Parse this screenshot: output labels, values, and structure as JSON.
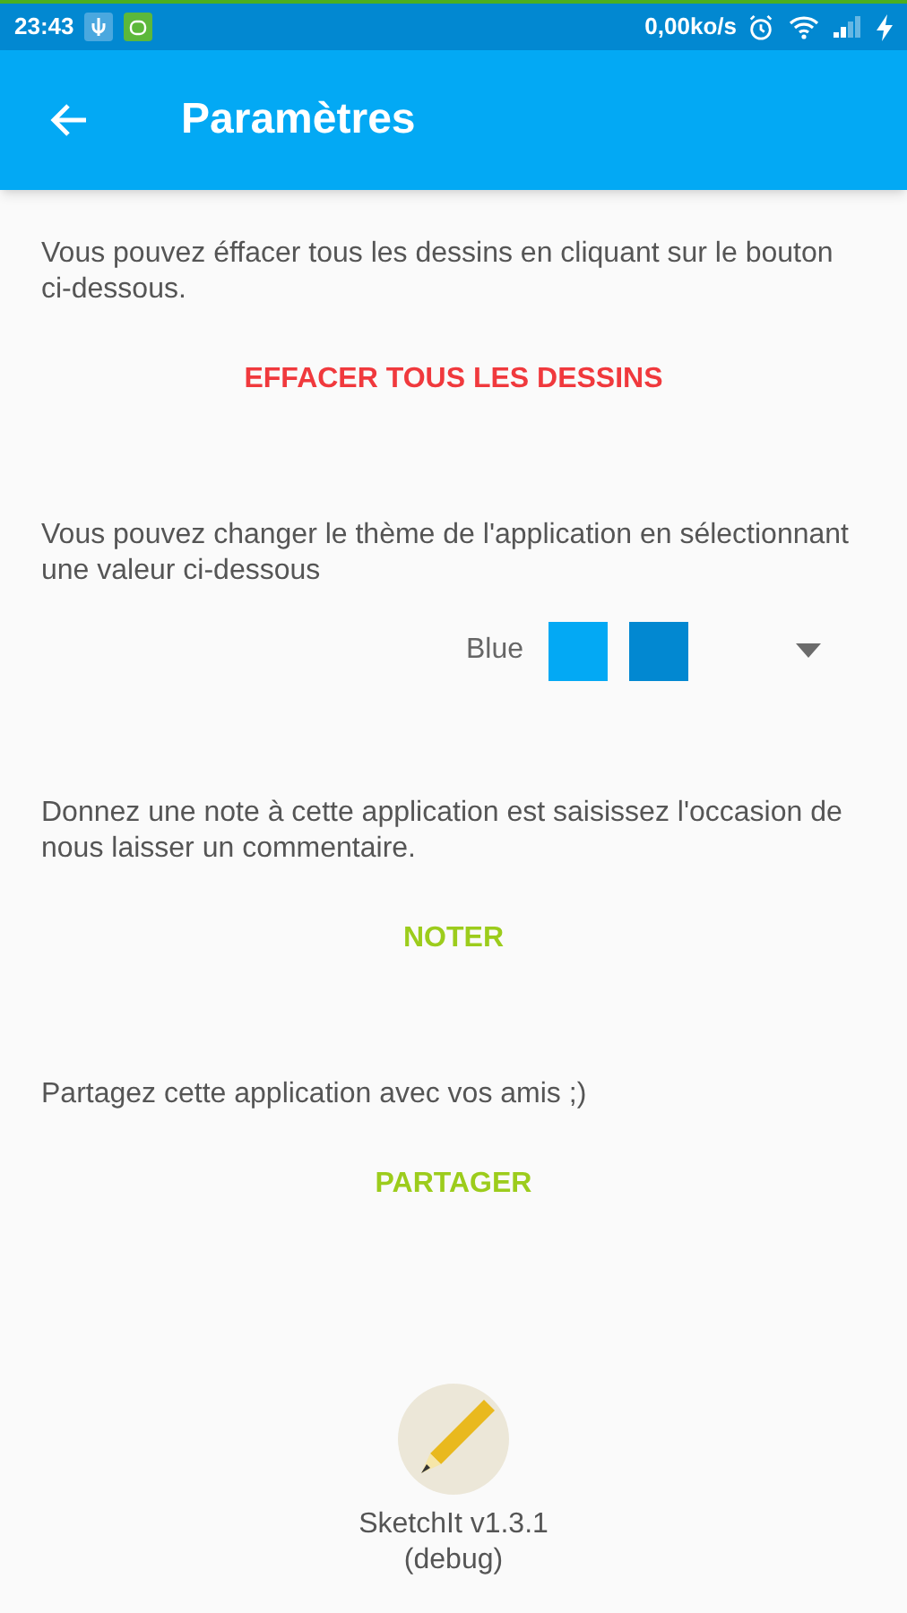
{
  "status_bar": {
    "time": "23:43",
    "speed": "0,00ko/s"
  },
  "app_bar": {
    "title": "Paramètres"
  },
  "sections": [
    {
      "text": "Vous pouvez éffacer tous les dessins en cliquant sur le bouton ci-dessous.",
      "kind": "button",
      "action": "EFFACER TOUS LES DESSINS",
      "color": "#f0393d"
    },
    {
      "text": "Vous pouvez changer le thème de l'application en sélectionnant une valeur ci-dessous",
      "kind": "theme",
      "theme": {
        "name": "Blue",
        "swatches": [
          {
            "color": "#03a9f4"
          },
          {
            "color": "#0288d1"
          }
        ]
      }
    },
    {
      "text": "Donnez une note à cette application est saisissez l'occasion de nous laisser un commentaire.",
      "kind": "button",
      "action": "NOTER",
      "color": "#9ccc1c"
    },
    {
      "text": "Partagez cette application avec vos amis ;)",
      "kind": "button",
      "action": "PARTAGER",
      "color": "#9ccc1c"
    }
  ],
  "footer": {
    "app_name": "SketchIt v1.3.1",
    "build": "(debug)"
  }
}
